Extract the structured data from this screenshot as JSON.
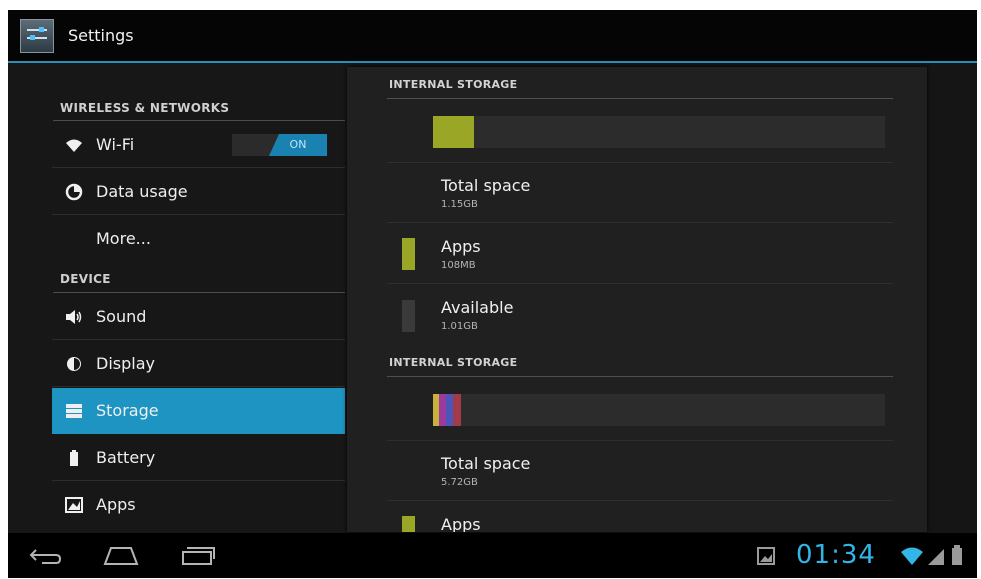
{
  "action_bar": {
    "title": "Settings"
  },
  "sidebar": {
    "sections": [
      {
        "header": "WIRELESS & NETWORKS"
      },
      {
        "header": "DEVICE"
      }
    ],
    "items": [
      {
        "label": "Wi-Fi",
        "icon": "wifi-icon",
        "toggle": "ON"
      },
      {
        "label": "Data usage",
        "icon": "data-usage-icon"
      },
      {
        "label": "More...",
        "icon": ""
      },
      {
        "label": "Sound",
        "icon": "speaker-icon"
      },
      {
        "label": "Display",
        "icon": "brightness-icon"
      },
      {
        "label": "Storage",
        "icon": "storage-icon",
        "selected": true
      },
      {
        "label": "Battery",
        "icon": "battery-icon"
      },
      {
        "label": "Apps",
        "icon": "apps-icon"
      }
    ]
  },
  "storage": {
    "sections": [
      {
        "header": "INTERNAL STORAGE",
        "usage_fraction": 0.09,
        "total": {
          "label": "Total space",
          "value": "1.15GB"
        },
        "apps": {
          "label": "Apps",
          "value": "108MB"
        },
        "available": {
          "label": "Available",
          "value": "1.01GB"
        }
      },
      {
        "header": "INTERNAL STORAGE",
        "usage_fraction": 0.06,
        "total": {
          "label": "Total space",
          "value": "5.72GB"
        },
        "apps": {
          "label": "Apps"
        }
      }
    ],
    "colors": {
      "apps": "#9aa626",
      "available": "#3a3a3a",
      "accent": "#33b5e5"
    }
  },
  "system_bar": {
    "clock": "01:34"
  }
}
